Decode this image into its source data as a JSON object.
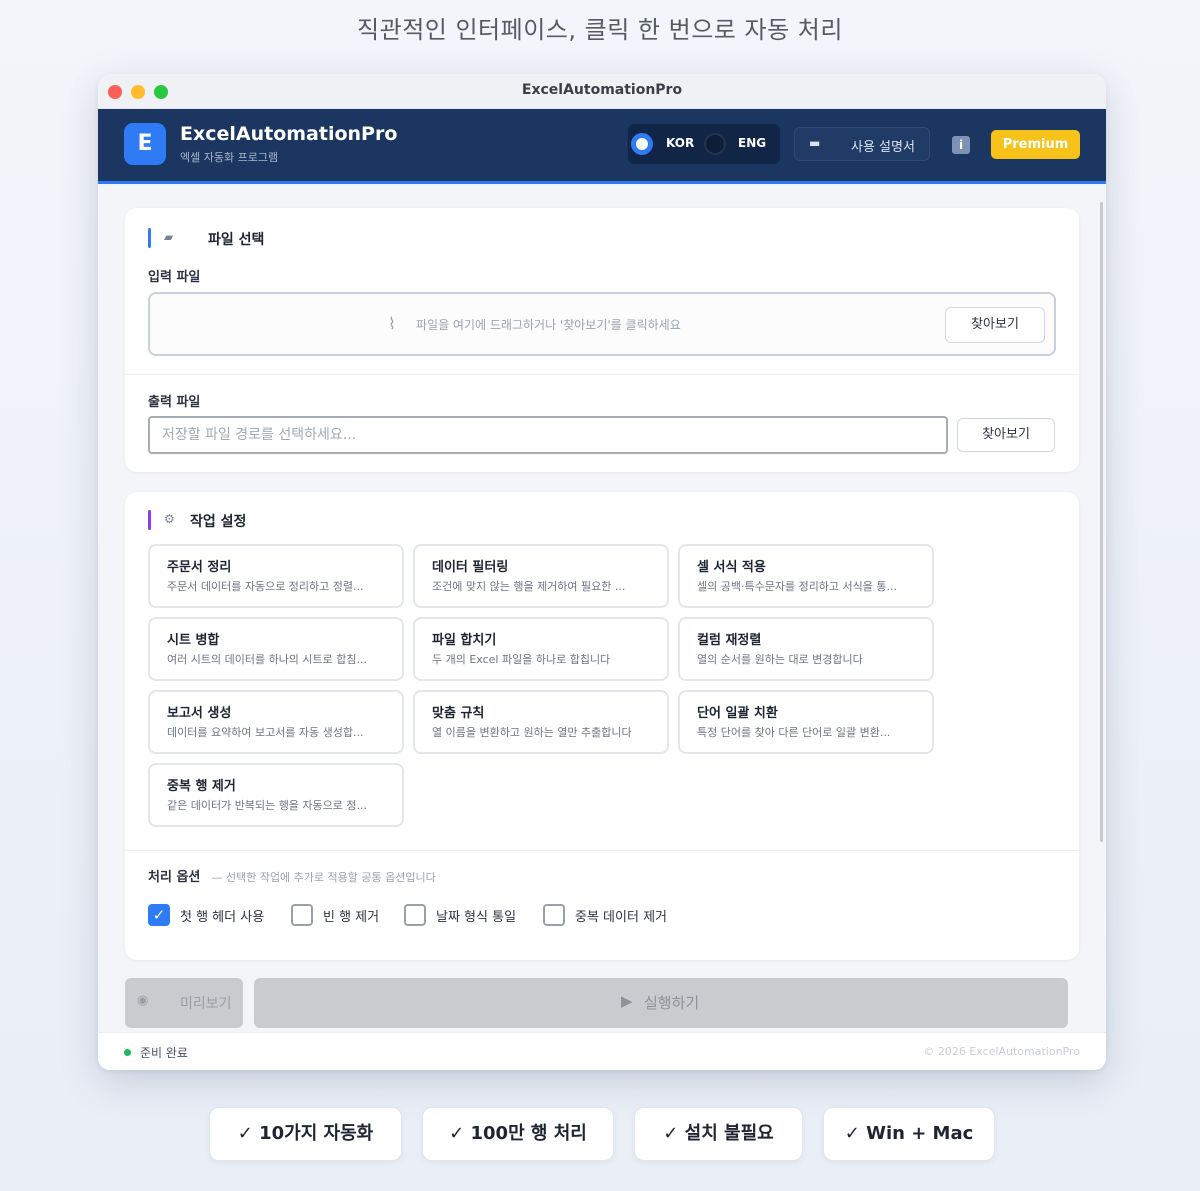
{
  "headline": "직관적인 인터페이스, 클릭 한 번으로 자동 처리",
  "window": {
    "title": "ExcelAutomationPro"
  },
  "app": {
    "logo_letter": "E",
    "name": "ExcelAutomationPro",
    "subtitle": "엑셀 자동화 프로그램"
  },
  "header": {
    "lang_kor": "KOR",
    "lang_eng": "ENG",
    "manual_label": "사용 설명서",
    "info_label": "i",
    "premium_label": "Premium"
  },
  "file_section": {
    "title": "파일 선택",
    "input_label": "입력 파일",
    "dropzone_text": "파일을 여기에 드래그하거나 '찾아보기'를 클릭하세요",
    "browse_label": "찾아보기",
    "output_label": "출력 파일",
    "output_placeholder": "저장할 파일 경로를 선택하세요...",
    "output_browse_label": "찾아보기"
  },
  "task_section": {
    "title": "작업 설정",
    "tasks": [
      {
        "title": "주문서 정리",
        "desc": "주문서 데이터를 자동으로 정리하고 정렬..."
      },
      {
        "title": "데이터 필터링",
        "desc": "조건에 맞지 않는 행을 제거하여 필요한 ..."
      },
      {
        "title": "셀 서식 적용",
        "desc": "셀의 공백·특수문자를 정리하고 서식을 통..."
      },
      {
        "title": "시트 병합",
        "desc": "여러 시트의 데이터를 하나의 시트로 합침..."
      },
      {
        "title": "파일 합치기",
        "desc": "두 개의 Excel 파일을 하나로 합칩니다"
      },
      {
        "title": "컬럼 재정렬",
        "desc": "열의 순서를 원하는 대로 변경합니다"
      },
      {
        "title": "보고서 생성",
        "desc": "데이터를 요약하여 보고서를 자동 생성합..."
      },
      {
        "title": "맞춤 규칙",
        "desc": "열 이름을 변환하고 원하는 열만 추출합니다"
      },
      {
        "title": "단어 일괄 치환",
        "desc": "특정 단어를 찾아 다른 단어로 일괄 변환..."
      },
      {
        "title": "중복 행 제거",
        "desc": "같은 데이터가 반복되는 행을 자동으로 정..."
      }
    ],
    "options_title": "처리 옵션",
    "options_desc": "— 선택한 작업에 추가로 적용할 공통 옵션입니다",
    "options": [
      {
        "label": "첫 행 헤더 사용",
        "checked": true
      },
      {
        "label": "빈 행 제거",
        "checked": false
      },
      {
        "label": "날짜 형식 통일",
        "checked": false
      },
      {
        "label": "중복 데이터 제거",
        "checked": false
      }
    ]
  },
  "actions": {
    "preview_label": "미리보기",
    "run_label": "실행하기"
  },
  "status": {
    "text": "준비 완료",
    "copyright": "© 2026 ExcelAutomationPro"
  },
  "features": [
    "✓ 10가지 자동화",
    "✓ 100만 행 처리",
    "✓ 설치 불필요",
    "✓ Win + Mac"
  ],
  "colors": {
    "accent": "#2f7bf5",
    "header_bg": "#1b3660",
    "premium": "#f7c21a",
    "status_ok": "#1eb858",
    "section1_bar": "#2f7bf5",
    "section2_bar": "#8b3cf0"
  }
}
